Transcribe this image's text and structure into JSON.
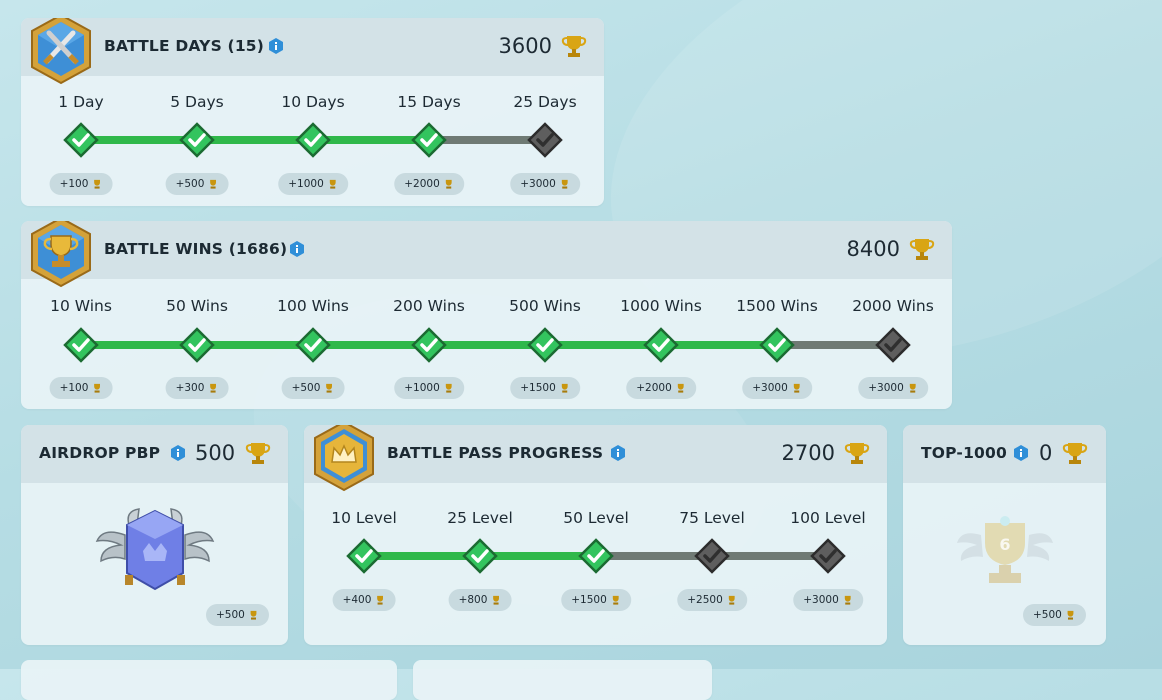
{
  "battle_days": {
    "title": "BATTLE DAYS (15)",
    "total": "3600",
    "milestones": [
      {
        "label": "1 Day",
        "reward": "+100",
        "done": true
      },
      {
        "label": "5 Days",
        "reward": "+500",
        "done": true
      },
      {
        "label": "10 Days",
        "reward": "+1000",
        "done": true
      },
      {
        "label": "15 Days",
        "reward": "+2000",
        "done": true
      },
      {
        "label": "25 Days",
        "reward": "+3000",
        "done": false
      }
    ]
  },
  "battle_wins": {
    "title": "BATTLE WINS (1686)",
    "total": "8400",
    "milestones": [
      {
        "label": "10 Wins",
        "reward": "+100",
        "done": true
      },
      {
        "label": "50 Wins",
        "reward": "+300",
        "done": true
      },
      {
        "label": "100 Wins",
        "reward": "+500",
        "done": true
      },
      {
        "label": "200 Wins",
        "reward": "+1000",
        "done": true
      },
      {
        "label": "500 Wins",
        "reward": "+1500",
        "done": true
      },
      {
        "label": "1000 Wins",
        "reward": "+2000",
        "done": true
      },
      {
        "label": "1500 Wins",
        "reward": "+3000",
        "done": true
      },
      {
        "label": "2000 Wins",
        "reward": "+3000",
        "done": false
      }
    ]
  },
  "airdrop": {
    "title": "AIRDROP PBP",
    "total": "500",
    "reward": "+500"
  },
  "battle_pass": {
    "title": "BATTLE PASS PROGRESS",
    "total": "2700",
    "milestones": [
      {
        "label": "10 Level",
        "reward": "+400",
        "done": true
      },
      {
        "label": "25 Level",
        "reward": "+800",
        "done": true
      },
      {
        "label": "50 Level",
        "reward": "+1500",
        "done": true
      },
      {
        "label": "75 Level",
        "reward": "+2500",
        "done": false
      },
      {
        "label": "100 Level",
        "reward": "+3000",
        "done": false
      }
    ]
  },
  "top1000": {
    "title": "TOP-1000",
    "total": "0",
    "rank_badge": "6",
    "reward": "+500"
  },
  "colors": {
    "done_track": "#2fb84a",
    "pending_track": "#6f7a74",
    "done_check": "#33c45e",
    "pending_check": "#5e5e5e",
    "badge_blue": "#3e8fd6",
    "badge_gold": "#d4a23a"
  },
  "icons": {
    "battle_days_badge": "crossed-swords-icon",
    "battle_wins_badge": "trophy-cup-icon",
    "battle_pass_badge": "crown-icon",
    "info": "info-icon",
    "trophy": "trophy-icon",
    "check": "check-icon"
  }
}
